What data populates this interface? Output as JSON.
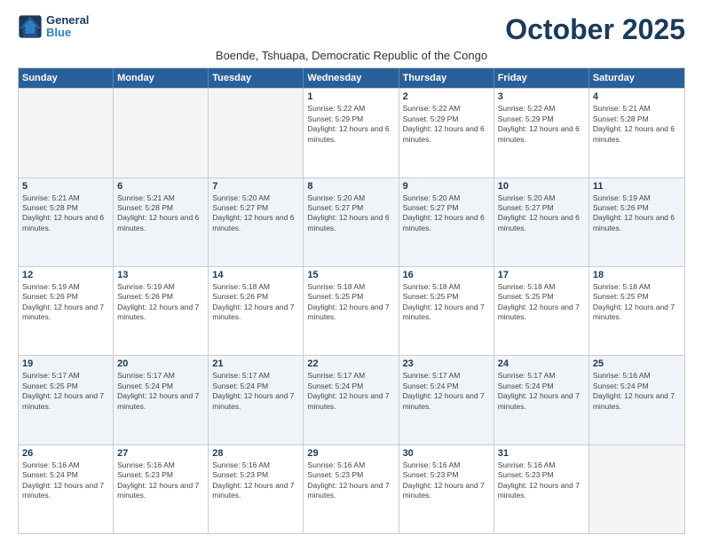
{
  "logo": {
    "line1": "General",
    "line2": "Blue",
    "icon_color": "#2d7fc1"
  },
  "title": "October 2025",
  "subtitle": "Boende, Tshuapa, Democratic Republic of the Congo",
  "header_days": [
    "Sunday",
    "Monday",
    "Tuesday",
    "Wednesday",
    "Thursday",
    "Friday",
    "Saturday"
  ],
  "weeks": [
    [
      {
        "day": "",
        "empty": true
      },
      {
        "day": "",
        "empty": true
      },
      {
        "day": "",
        "empty": true
      },
      {
        "day": "1",
        "sunrise": "5:22 AM",
        "sunset": "5:29 PM",
        "daylight": "12 hours and 6 minutes."
      },
      {
        "day": "2",
        "sunrise": "5:22 AM",
        "sunset": "5:29 PM",
        "daylight": "12 hours and 6 minutes."
      },
      {
        "day": "3",
        "sunrise": "5:22 AM",
        "sunset": "5:29 PM",
        "daylight": "12 hours and 6 minutes."
      },
      {
        "day": "4",
        "sunrise": "5:21 AM",
        "sunset": "5:28 PM",
        "daylight": "12 hours and 6 minutes."
      }
    ],
    [
      {
        "day": "5",
        "sunrise": "5:21 AM",
        "sunset": "5:28 PM",
        "daylight": "12 hours and 6 minutes."
      },
      {
        "day": "6",
        "sunrise": "5:21 AM",
        "sunset": "5:28 PM",
        "daylight": "12 hours and 6 minutes."
      },
      {
        "day": "7",
        "sunrise": "5:20 AM",
        "sunset": "5:27 PM",
        "daylight": "12 hours and 6 minutes."
      },
      {
        "day": "8",
        "sunrise": "5:20 AM",
        "sunset": "5:27 PM",
        "daylight": "12 hours and 6 minutes."
      },
      {
        "day": "9",
        "sunrise": "5:20 AM",
        "sunset": "5:27 PM",
        "daylight": "12 hours and 6 minutes."
      },
      {
        "day": "10",
        "sunrise": "5:20 AM",
        "sunset": "5:27 PM",
        "daylight": "12 hours and 6 minutes."
      },
      {
        "day": "11",
        "sunrise": "5:19 AM",
        "sunset": "5:26 PM",
        "daylight": "12 hours and 6 minutes."
      }
    ],
    [
      {
        "day": "12",
        "sunrise": "5:19 AM",
        "sunset": "5:26 PM",
        "daylight": "12 hours and 7 minutes."
      },
      {
        "day": "13",
        "sunrise": "5:19 AM",
        "sunset": "5:26 PM",
        "daylight": "12 hours and 7 minutes."
      },
      {
        "day": "14",
        "sunrise": "5:18 AM",
        "sunset": "5:26 PM",
        "daylight": "12 hours and 7 minutes."
      },
      {
        "day": "15",
        "sunrise": "5:18 AM",
        "sunset": "5:25 PM",
        "daylight": "12 hours and 7 minutes."
      },
      {
        "day": "16",
        "sunrise": "5:18 AM",
        "sunset": "5:25 PM",
        "daylight": "12 hours and 7 minutes."
      },
      {
        "day": "17",
        "sunrise": "5:18 AM",
        "sunset": "5:25 PM",
        "daylight": "12 hours and 7 minutes."
      },
      {
        "day": "18",
        "sunrise": "5:18 AM",
        "sunset": "5:25 PM",
        "daylight": "12 hours and 7 minutes."
      }
    ],
    [
      {
        "day": "19",
        "sunrise": "5:17 AM",
        "sunset": "5:25 PM",
        "daylight": "12 hours and 7 minutes."
      },
      {
        "day": "20",
        "sunrise": "5:17 AM",
        "sunset": "5:24 PM",
        "daylight": "12 hours and 7 minutes."
      },
      {
        "day": "21",
        "sunrise": "5:17 AM",
        "sunset": "5:24 PM",
        "daylight": "12 hours and 7 minutes."
      },
      {
        "day": "22",
        "sunrise": "5:17 AM",
        "sunset": "5:24 PM",
        "daylight": "12 hours and 7 minutes."
      },
      {
        "day": "23",
        "sunrise": "5:17 AM",
        "sunset": "5:24 PM",
        "daylight": "12 hours and 7 minutes."
      },
      {
        "day": "24",
        "sunrise": "5:17 AM",
        "sunset": "5:24 PM",
        "daylight": "12 hours and 7 minutes."
      },
      {
        "day": "25",
        "sunrise": "5:16 AM",
        "sunset": "5:24 PM",
        "daylight": "12 hours and 7 minutes."
      }
    ],
    [
      {
        "day": "26",
        "sunrise": "5:16 AM",
        "sunset": "5:24 PM",
        "daylight": "12 hours and 7 minutes."
      },
      {
        "day": "27",
        "sunrise": "5:16 AM",
        "sunset": "5:23 PM",
        "daylight": "12 hours and 7 minutes."
      },
      {
        "day": "28",
        "sunrise": "5:16 AM",
        "sunset": "5:23 PM",
        "daylight": "12 hours and 7 minutes."
      },
      {
        "day": "29",
        "sunrise": "5:16 AM",
        "sunset": "5:23 PM",
        "daylight": "12 hours and 7 minutes."
      },
      {
        "day": "30",
        "sunrise": "5:16 AM",
        "sunset": "5:23 PM",
        "daylight": "12 hours and 7 minutes."
      },
      {
        "day": "31",
        "sunrise": "5:16 AM",
        "sunset": "5:23 PM",
        "daylight": "12 hours and 7 minutes."
      },
      {
        "day": "",
        "empty": true
      }
    ]
  ]
}
